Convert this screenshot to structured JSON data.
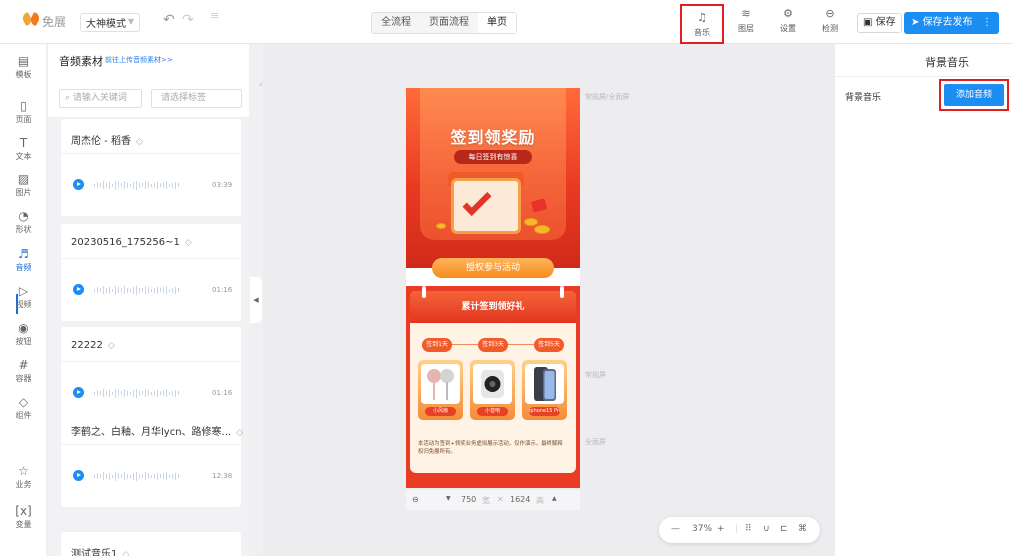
{
  "app": {
    "logo": "免展"
  },
  "topbar": {
    "mode": "大神模式",
    "flow_tabs": [
      "全流程",
      "页面流程",
      "单页"
    ],
    "tools": [
      {
        "name": "music",
        "icon": "♫",
        "label": "音乐"
      },
      {
        "name": "layers",
        "icon": "≋",
        "label": "图层"
      },
      {
        "name": "settings",
        "icon": "⚙",
        "label": "设置"
      },
      {
        "name": "check",
        "icon": "⊖",
        "label": "检测"
      }
    ],
    "save": "保存",
    "publish": "保存去发布"
  },
  "leftnav": [
    {
      "icon": "▤",
      "label": "模板"
    },
    {
      "icon": "▯",
      "label": "页面"
    },
    {
      "icon": "T",
      "label": "文本"
    },
    {
      "icon": "▨",
      "label": "图片"
    },
    {
      "icon": "◔",
      "label": "形状"
    },
    {
      "icon": "♬",
      "label": "音频"
    },
    {
      "icon": "▷",
      "label": "视频"
    },
    {
      "icon": "◉",
      "label": "按钮"
    },
    {
      "icon": "#",
      "label": "容器"
    },
    {
      "icon": "◇",
      "label": "组件"
    },
    {
      "icon": "☆",
      "label": "业务"
    },
    {
      "icon": "[x]",
      "label": "变量"
    }
  ],
  "assets": {
    "title": "音频素材",
    "upload_link": "前往上传音频素材>>",
    "keyword_placeholder": "请输入关键词",
    "tag_placeholder": "请选择标签",
    "items": [
      {
        "title": "周杰伦 - 稻香",
        "duration": "03:39"
      },
      {
        "title": "20230516_175256~1",
        "duration": "01:16"
      },
      {
        "title": "22222",
        "duration": "01:16"
      },
      {
        "title": "李鹤之、白釉、月华lycn、路修寒...",
        "duration": "12:38"
      },
      {
        "title": "测试音乐1",
        "duration": ""
      }
    ]
  },
  "phone": {
    "title": "签到领奖励",
    "subtitle": "每日签到有惊喜",
    "join_button": "授权参与活动",
    "section_title": "累计签到领好礼",
    "days": [
      "签到1天",
      "签到3天",
      "签到5天"
    ],
    "prizes": [
      "小风扇",
      "小音响",
      "iphone15 Pro"
    ],
    "note": "本活动为签到+领奖业务虚拟展示活动，仅作演示，最终解释权归免展所有。"
  },
  "canvas": {
    "guides": [
      "常规屏/全面屏",
      "常规屏",
      "全面屏"
    ],
    "width": "750",
    "width_unit": "宽",
    "height": "1624",
    "height_unit": "高",
    "zoom": "37%"
  },
  "right": {
    "title": "背景音乐",
    "bgm_label": "背景音乐",
    "add_audio": "添加音频"
  }
}
